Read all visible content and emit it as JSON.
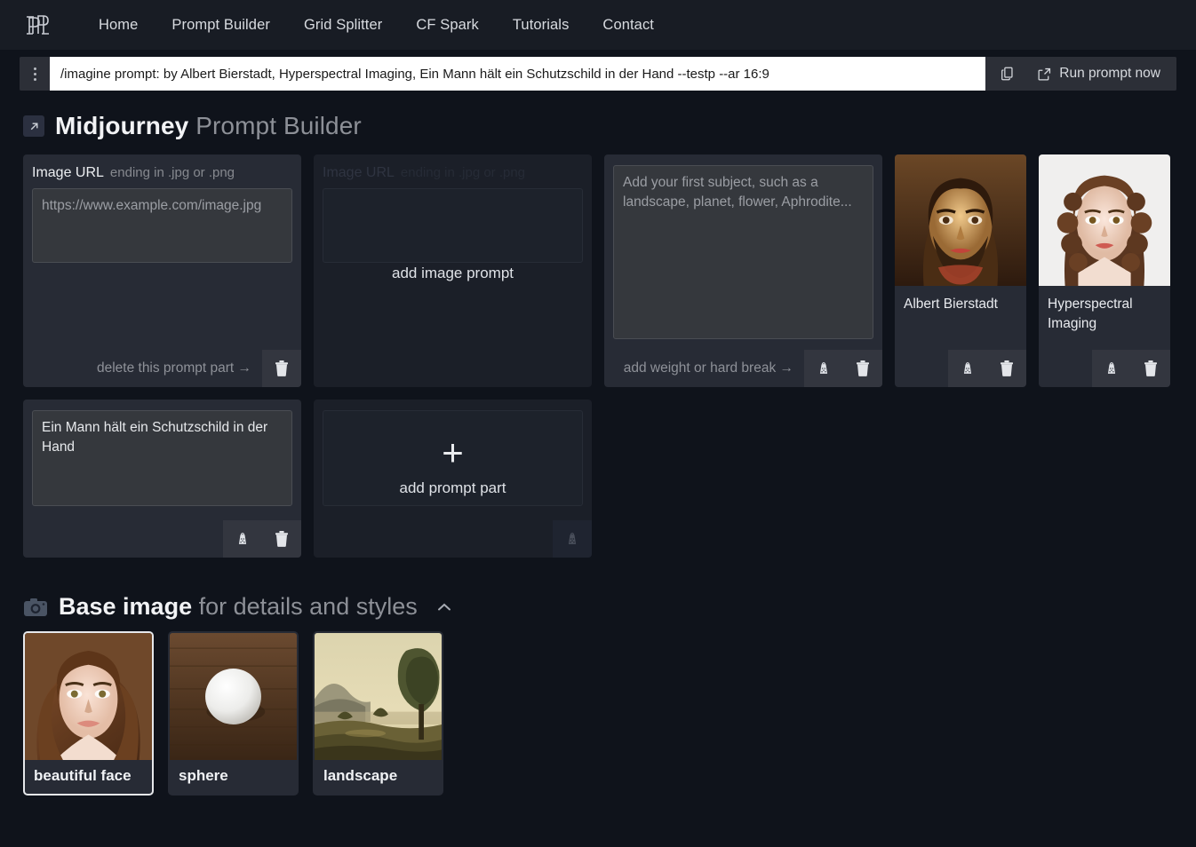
{
  "nav": {
    "logo_icon": "pm-monogram-logo",
    "items": [
      {
        "label": "Home"
      },
      {
        "label": "Prompt Builder"
      },
      {
        "label": "Grid Splitter"
      },
      {
        "label": "CF Spark"
      },
      {
        "label": "Tutorials"
      },
      {
        "label": "Contact"
      }
    ]
  },
  "prompt_bar": {
    "drag_handle_icon": "drag-handle-icon",
    "value": "/imagine prompt: by Albert Bierstadt, Hyperspectral Imaging, Ein Mann hält ein Schutzschild in der Hand --testp --ar 16:9",
    "placeholder": "/imagine prompt:",
    "copy_icon": "copy-icon",
    "run_icon": "external-link-icon",
    "run_label": "Run prompt now"
  },
  "page": {
    "title_icon": "external-link-badge-icon",
    "title_strong": "Midjourney",
    "title_dim": "Prompt Builder"
  },
  "cards": [
    {
      "kind": "image-url",
      "head_label": "Image URL",
      "head_hint": "ending in .jpg or .png",
      "value": "",
      "placeholder": "https://www.example.com/image.jpg",
      "foot_label": "delete this prompt part →",
      "buttons": [
        "trash-icon"
      ]
    },
    {
      "kind": "image-url-ghost",
      "head_label": "Image URL",
      "head_hint": "ending in .jpg or .png",
      "value": "",
      "placeholder": "",
      "overlay_label": "add image prompt",
      "buttons": []
    },
    {
      "kind": "subject",
      "value": "",
      "placeholder": "Add your first subject, such as a landscape, planet, flower, Aphrodite...",
      "foot_label": "add weight or hard break →",
      "buttons": [
        "weight-icon",
        "trash-icon"
      ]
    },
    {
      "kind": "image-thumb",
      "caption": "Albert Bierstadt",
      "thumb": "portrait-bearded-man",
      "buttons": [
        "weight-icon",
        "trash-icon"
      ]
    },
    {
      "kind": "image-thumb",
      "caption": "Hyperspectral Imaging",
      "thumb": "portrait-curly-haired-woman",
      "buttons": [
        "weight-icon",
        "trash-icon"
      ]
    },
    {
      "kind": "text-part",
      "value": "Ein Mann hält ein Schutzschild in der Hand",
      "placeholder": "",
      "foot_label": "",
      "buttons": [
        "weight-icon",
        "trash-icon"
      ]
    },
    {
      "kind": "add-part",
      "overlay_plus": "+",
      "overlay_label": "add prompt part",
      "buttons": [
        "weight-icon"
      ]
    }
  ],
  "base_image": {
    "icon": "camera-icon",
    "title_strong": "Base image",
    "title_dim": "for details and styles",
    "collapse_icon": "chevron-up-icon",
    "items": [
      {
        "label": "beautiful face",
        "thumb": "woman-portrait",
        "selected": true
      },
      {
        "label": "sphere",
        "thumb": "white-sphere-on-wood",
        "selected": false
      },
      {
        "label": "landscape",
        "thumb": "painted-landscape",
        "selected": false
      }
    ]
  },
  "colors": {
    "page_bg": "#0f131b",
    "header_bg": "#181c24",
    "card_bg": "#272b35",
    "field_bg": "#35383d",
    "text": "#e9ebef",
    "muted": "#8d9097",
    "selected_border": "#e6e8eb"
  }
}
